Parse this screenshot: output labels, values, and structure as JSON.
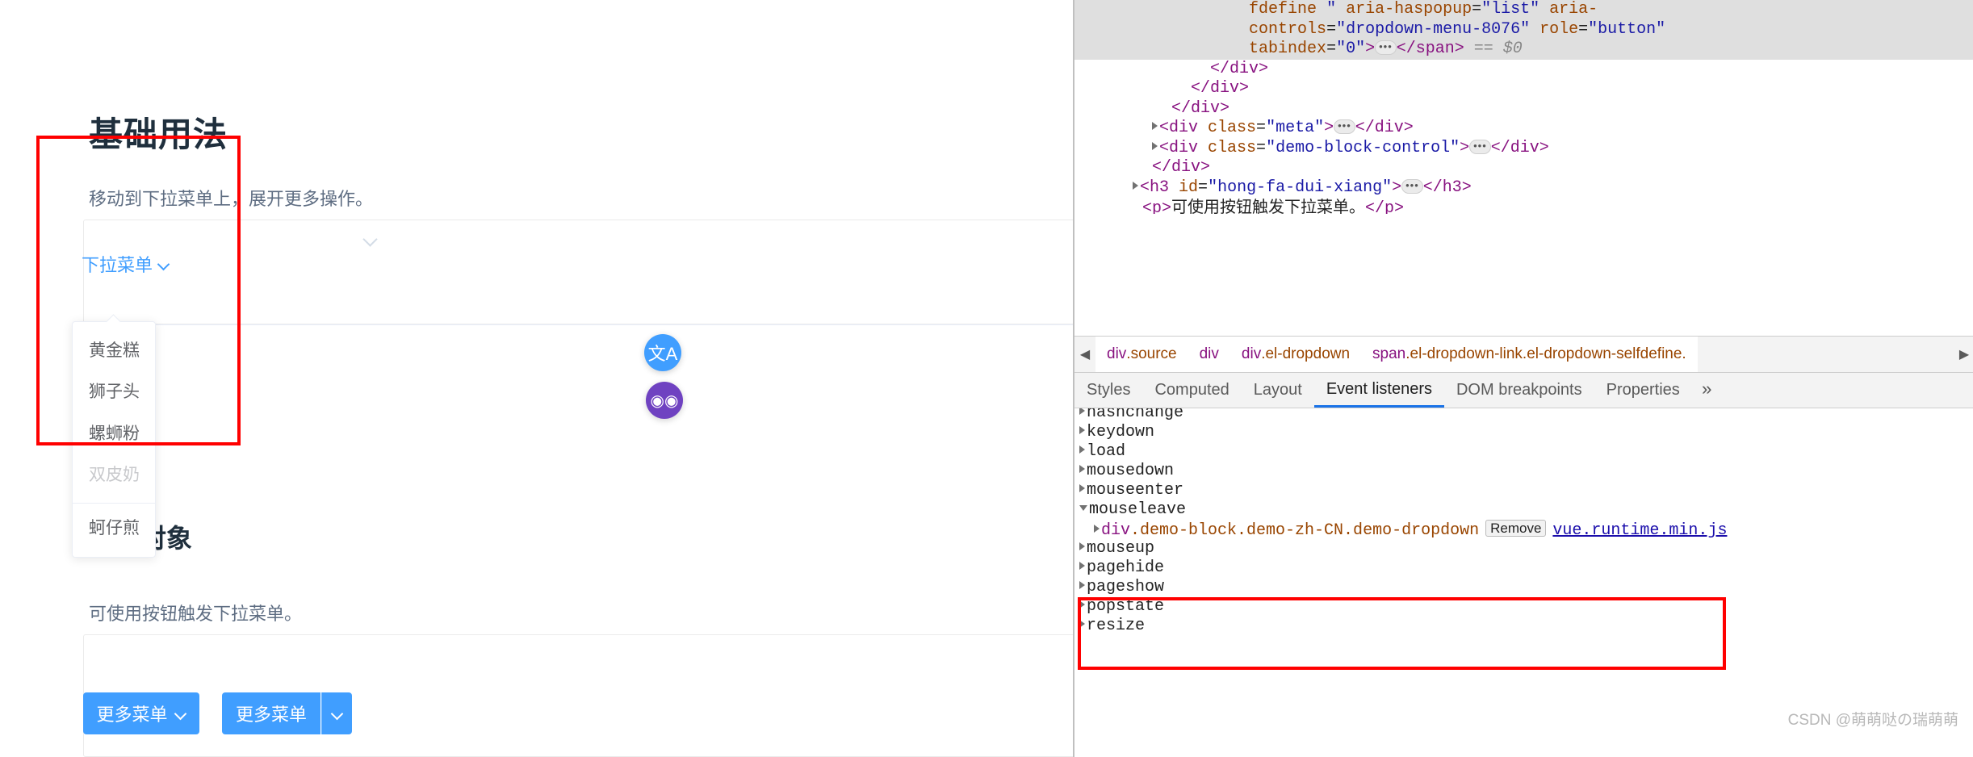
{
  "doc": {
    "heading": "基础用法",
    "intro": "移动到下拉菜单上，展开更多操作。",
    "heading2": "触发对象",
    "intro2": "可使用按钮触发下拉菜单。",
    "dropdown_link_label": "下拉菜单",
    "dropdown_items": [
      {
        "label": "黄金糕",
        "disabled": false,
        "divided": false
      },
      {
        "label": "狮子头",
        "disabled": false,
        "divided": false
      },
      {
        "label": "螺蛳粉",
        "disabled": false,
        "divided": false
      },
      {
        "label": "双皮奶",
        "disabled": true,
        "divided": false
      },
      {
        "label": "蚵仔煎",
        "disabled": false,
        "divided": true
      }
    ],
    "buttons": {
      "more_menu": "更多菜单",
      "more_menu_group": "更多菜单"
    },
    "float_buttons": {
      "translate": "文A",
      "eye": "◉◉"
    },
    "accent_color": "#409eff"
  },
  "devtools": {
    "dom_lines": [
      {
        "selected": true,
        "parts": [
          {
            "t": "space",
            "v": "                  "
          },
          {
            "t": "attr",
            "v": "fdefine"
          },
          {
            "t": "val",
            "v": " \" "
          },
          {
            "t": "attr",
            "v": "aria-haspopup"
          },
          {
            "t": "plain",
            "v": "="
          },
          {
            "t": "val",
            "v": "\"list\""
          },
          {
            "t": "plain",
            "v": " "
          },
          {
            "t": "attr",
            "v": "aria-"
          }
        ]
      },
      {
        "selected": true,
        "parts": [
          {
            "t": "space",
            "v": "                  "
          },
          {
            "t": "attr",
            "v": "controls"
          },
          {
            "t": "plain",
            "v": "="
          },
          {
            "t": "val",
            "v": "\"dropdown-menu-8076\""
          },
          {
            "t": "plain",
            "v": " "
          },
          {
            "t": "attr",
            "v": "role"
          },
          {
            "t": "plain",
            "v": "="
          },
          {
            "t": "val",
            "v": "\"button\""
          }
        ]
      },
      {
        "selected": true,
        "parts": [
          {
            "t": "space",
            "v": "                  "
          },
          {
            "t": "attr",
            "v": "tabindex"
          },
          {
            "t": "plain",
            "v": "="
          },
          {
            "t": "val",
            "v": "\"0\""
          },
          {
            "t": "tag",
            "v": ">"
          },
          {
            "t": "badge",
            "v": "…"
          },
          {
            "t": "tag",
            "v": "</span>"
          },
          {
            "t": "eq0",
            "v": " == $0"
          }
        ]
      },
      {
        "selected": false,
        "parts": [
          {
            "t": "space",
            "v": "              "
          },
          {
            "t": "tag",
            "v": "</div>"
          }
        ]
      },
      {
        "selected": false,
        "parts": [
          {
            "t": "space",
            "v": "            "
          },
          {
            "t": "tag",
            "v": "</div>"
          }
        ]
      },
      {
        "selected": false,
        "parts": [
          {
            "t": "space",
            "v": "          "
          },
          {
            "t": "tag",
            "v": "</div>"
          }
        ]
      },
      {
        "selected": false,
        "collapsed": true,
        "indent": 8,
        "parts": [
          {
            "t": "tag",
            "v": "<div "
          },
          {
            "t": "attr",
            "v": "class"
          },
          {
            "t": "plain",
            "v": "="
          },
          {
            "t": "val",
            "v": "\"meta\""
          },
          {
            "t": "tag",
            "v": ">"
          },
          {
            "t": "badge",
            "v": "…"
          },
          {
            "t": "tag",
            "v": "</div>"
          }
        ]
      },
      {
        "selected": false,
        "collapsed": true,
        "indent": 8,
        "parts": [
          {
            "t": "tag",
            "v": "<div "
          },
          {
            "t": "attr",
            "v": "class"
          },
          {
            "t": "plain",
            "v": "="
          },
          {
            "t": "val",
            "v": "\"demo-block-control\""
          },
          {
            "t": "tag",
            "v": ">"
          },
          {
            "t": "badge",
            "v": "…"
          },
          {
            "t": "tag",
            "v": "</div>"
          }
        ]
      },
      {
        "selected": false,
        "parts": [
          {
            "t": "space",
            "v": "        "
          },
          {
            "t": "tag",
            "v": "</div>"
          }
        ]
      },
      {
        "selected": false,
        "collapsed": true,
        "indent": 6,
        "parts": [
          {
            "t": "tag",
            "v": "<h3 "
          },
          {
            "t": "attr",
            "v": "id"
          },
          {
            "t": "plain",
            "v": "="
          },
          {
            "t": "val",
            "v": "\"hong-fa-dui-xiang\""
          },
          {
            "t": "tag",
            "v": ">"
          },
          {
            "t": "badge",
            "v": "…"
          },
          {
            "t": "tag",
            "v": "</h3>"
          }
        ]
      },
      {
        "selected": false,
        "parts": [
          {
            "t": "space",
            "v": "       "
          },
          {
            "t": "tag",
            "v": "<p>"
          },
          {
            "t": "txt",
            "v": "可使用按钮触发下拉菜单。"
          },
          {
            "t": "tag",
            "v": "</p>"
          }
        ]
      }
    ],
    "breadcrumb": [
      {
        "tag": "div",
        "cls": ".source"
      },
      {
        "tag": "div",
        "cls": ""
      },
      {
        "tag": "div",
        "cls": ".el-dropdown"
      },
      {
        "tag": "span",
        "cls": ".el-dropdown-link.el-dropdown-selfdefine."
      }
    ],
    "tabs": [
      {
        "label": "Styles",
        "active": false
      },
      {
        "label": "Computed",
        "active": false
      },
      {
        "label": "Layout",
        "active": false
      },
      {
        "label": "Event listeners",
        "active": true
      },
      {
        "label": "DOM breakpoints",
        "active": false
      },
      {
        "label": "Properties",
        "active": false
      }
    ],
    "tabs_overflow": "»",
    "listeners": [
      {
        "name": "hashchange",
        "expanded": false,
        "clipped": true
      },
      {
        "name": "keydown",
        "expanded": false
      },
      {
        "name": "load",
        "expanded": false
      },
      {
        "name": "mousedown",
        "expanded": false
      },
      {
        "name": "mouseenter",
        "expanded": false
      },
      {
        "name": "mouseleave",
        "expanded": true,
        "children": [
          {
            "node": "div",
            "classes": ".demo-block.demo-zh-CN.demo-dropdown",
            "remove_label": "Remove",
            "source": "vue.runtime.min.js"
          }
        ]
      },
      {
        "name": "mouseup",
        "expanded": false
      },
      {
        "name": "pagehide",
        "expanded": false
      },
      {
        "name": "pageshow",
        "expanded": false
      },
      {
        "name": "popstate",
        "expanded": false
      },
      {
        "name": "resize",
        "expanded": false
      }
    ]
  },
  "watermark": "CSDN @萌萌哒の瑞萌萌"
}
